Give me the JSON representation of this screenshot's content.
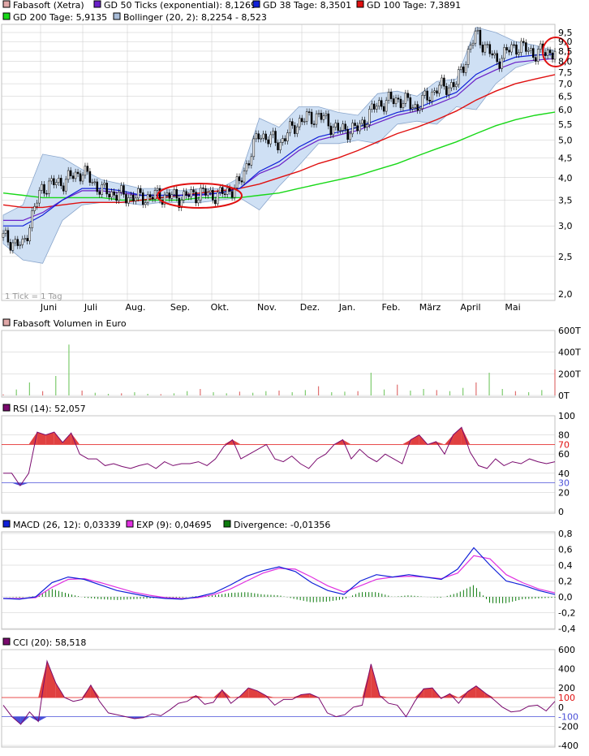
{
  "colors": {
    "gd50": "#6a1fc8",
    "gd38": "#1020d8",
    "gd100": "#e01010",
    "gd200": "#18d818",
    "boll_fill": "#cfe0f4",
    "boll_line": "#8aa6cc",
    "volume": "#7ecb6e",
    "rsi_line": "#7a0a6e",
    "rsi_fill": "#e04040",
    "rsi_low_fill": "#4a50d8",
    "macd": "#1020d8",
    "exp": "#e030e0",
    "divergence": "#0c7a0c",
    "grid": "#c8c8c8"
  },
  "price_panel": {
    "legend": [
      {
        "label": "Fabasoft (Xetra)",
        "color": "#e0a8a8"
      },
      {
        "label": "GD 50 Ticks (exponential): 8,1269",
        "color": "#6a1fc8"
      },
      {
        "label": "GD 38 Tage: 8,3501",
        "color": "#1020d8"
      },
      {
        "label": "GD 100 Tage: 7,3891",
        "color": "#e01010"
      },
      {
        "label": "GD 200 Tage: 5,9135",
        "color": "#18d818"
      },
      {
        "label": "Bollinger (20, 2): 8,2254  - 8,523",
        "color": "#a8bcd8"
      }
    ],
    "tick_note": "1 Tick = 1 Tag",
    "y_labels": [
      "9,5",
      "9,0",
      "8,5",
      "8,0",
      "7,5",
      "7,0",
      "6,5",
      "6,0",
      "5,5",
      "5,0",
      "4,5",
      "4,0",
      "3,5",
      "3,0",
      "2,5",
      "2,0"
    ],
    "x_labels": [
      "Juni",
      "Juli",
      "Aug.",
      "Sep.",
      "Okt.",
      "Nov.",
      "Dez.",
      "Jan.",
      "Feb.",
      "März",
      "April",
      "Mai"
    ]
  },
  "volume_panel": {
    "legend": {
      "label": "Fabasoft Volumen in Euro",
      "color": "#e0a8a8"
    },
    "y_labels": [
      "600T",
      "400T",
      "200T",
      "0T"
    ]
  },
  "rsi_panel": {
    "legend": {
      "label": "RSI (14): 52,057",
      "color": "#7a0a6e"
    },
    "y_labels": [
      "100",
      "80",
      "70",
      "60",
      "40",
      "30",
      "20",
      "0"
    ]
  },
  "macd_panel": {
    "legend": [
      {
        "label": "MACD (26, 12): 0,03339",
        "color": "#1020d8"
      },
      {
        "label": "EXP (9): 0,04695",
        "color": "#e030e0"
      },
      {
        "label": "Divergence: -0,01356",
        "color": "#0c7a0c"
      }
    ],
    "y_labels": [
      "0,8",
      "0,6",
      "0,4",
      "0,2",
      "0,0",
      "-0,2",
      "-0,4"
    ]
  },
  "cci_panel": {
    "legend": {
      "label": "CCI (20): 58,518",
      "color": "#7a0a6e"
    },
    "y_labels": [
      "600",
      "400",
      "200",
      "0",
      "100",
      "-100",
      "-200",
      "-400"
    ]
  },
  "chart_data": [
    {
      "type": "line",
      "title": "Fabasoft (Xetra)",
      "log_scale": true,
      "ylim": [
        2.0,
        9.5
      ],
      "x_ticks": [
        "Juni",
        "Juli",
        "Aug.",
        "Sep.",
        "Okt.",
        "Nov.",
        "Dez.",
        "Jan.",
        "Feb.",
        "März",
        "April",
        "Mai"
      ],
      "series": [
        {
          "name": "Fabasoft (Xetra)",
          "values": [
            2.8,
            2.65,
            3.8,
            3.9,
            4.15,
            3.7,
            3.6,
            3.55,
            3.6,
            3.55,
            3.65,
            3.6,
            3.85,
            5.2,
            4.9,
            5.6,
            5.8,
            5.3,
            5.35,
            6.2,
            6.4,
            6.1,
            6.8,
            7.0,
            9.4,
            8.0,
            8.8,
            8.4,
            8.5
          ]
        },
        {
          "name": "GD 50 Ticks (exponential)",
          "values": [
            3.1,
            3.1,
            3.25,
            3.5,
            3.7,
            3.7,
            3.65,
            3.6,
            3.6,
            3.6,
            3.6,
            3.65,
            3.75,
            4.1,
            4.3,
            4.7,
            5.0,
            5.15,
            5.3,
            5.55,
            5.8,
            5.95,
            6.2,
            6.5,
            7.2,
            7.6,
            7.95,
            8.05,
            8.13
          ]
        },
        {
          "name": "GD 38 Tage",
          "values": [
            3.0,
            3.0,
            3.2,
            3.5,
            3.75,
            3.75,
            3.7,
            3.6,
            3.6,
            3.6,
            3.62,
            3.65,
            3.75,
            4.15,
            4.4,
            4.8,
            5.1,
            5.25,
            5.4,
            5.65,
            5.9,
            6.05,
            6.35,
            6.65,
            7.4,
            7.85,
            8.2,
            8.3,
            8.35
          ]
        },
        {
          "name": "GD 100 Tage",
          "values": [
            3.4,
            3.35,
            3.35,
            3.4,
            3.45,
            3.45,
            3.45,
            3.5,
            3.55,
            3.6,
            3.65,
            3.7,
            3.75,
            3.85,
            4.0,
            4.15,
            4.35,
            4.5,
            4.7,
            4.95,
            5.2,
            5.4,
            5.65,
            5.95,
            6.35,
            6.7,
            7.0,
            7.2,
            7.39
          ]
        },
        {
          "name": "GD 200 Tage",
          "values": [
            3.65,
            3.6,
            3.55,
            3.55,
            3.55,
            3.55,
            3.5,
            3.5,
            3.5,
            3.5,
            3.55,
            3.55,
            3.55,
            3.6,
            3.65,
            3.75,
            3.85,
            3.95,
            4.05,
            4.2,
            4.35,
            4.55,
            4.75,
            4.95,
            5.2,
            5.45,
            5.65,
            5.8,
            5.91
          ]
        },
        {
          "name": "Bollinger (20, 2) upper",
          "values": [
            3.2,
            3.4,
            4.6,
            4.5,
            4.2,
            3.95,
            3.85,
            3.75,
            3.75,
            3.7,
            3.75,
            3.75,
            4.0,
            5.7,
            5.4,
            6.1,
            6.1,
            5.9,
            5.8,
            6.6,
            6.7,
            6.5,
            7.1,
            7.2,
            9.8,
            9.5,
            9.0,
            8.8,
            8.52
          ]
        },
        {
          "name": "Bollinger (20, 2) lower",
          "values": [
            2.7,
            2.45,
            2.4,
            3.1,
            3.4,
            3.45,
            3.45,
            3.4,
            3.45,
            3.45,
            3.45,
            3.5,
            3.55,
            3.3,
            3.8,
            4.3,
            4.9,
            4.9,
            5.0,
            4.9,
            5.5,
            5.6,
            5.5,
            6.1,
            6.0,
            7.0,
            7.7,
            8.0,
            8.23
          ]
        }
      ]
    },
    {
      "type": "bar",
      "title": "Fabasoft Volumen in Euro",
      "ylim": [
        0,
        600
      ],
      "unit": "T",
      "values": [
        10,
        55,
        120,
        40,
        180,
        470,
        45,
        25,
        15,
        20,
        30,
        15,
        12,
        20,
        40,
        60,
        30,
        20,
        35,
        25,
        40,
        45,
        30,
        50,
        85,
        30,
        35,
        40,
        210,
        55,
        100,
        45,
        60,
        50,
        40,
        70,
        120,
        210,
        60,
        40,
        30,
        50,
        240
      ]
    },
    {
      "type": "line",
      "title": "RSI (14)",
      "ylim": [
        0,
        100
      ],
      "reference_lines": [
        70,
        30
      ],
      "values": [
        40,
        40,
        27,
        40,
        83,
        80,
        83,
        72,
        82,
        60,
        55,
        55,
        48,
        50,
        47,
        45,
        48,
        50,
        45,
        52,
        48,
        50,
        50,
        52,
        48,
        55,
        68,
        75,
        55,
        60,
        65,
        70,
        55,
        52,
        58,
        50,
        45,
        55,
        60,
        70,
        75,
        55,
        65,
        57,
        52,
        60,
        55,
        50,
        75,
        80,
        70,
        73,
        60,
        80,
        88,
        62,
        48,
        45,
        55,
        48,
        52,
        50,
        55,
        52,
        50,
        52
      ]
    },
    {
      "type": "line",
      "title": "MACD (26, 12)",
      "ylim": [
        -0.4,
        0.8
      ],
      "series": [
        {
          "name": "MACD (26, 12)",
          "values": [
            -0.02,
            -0.03,
            0.0,
            0.18,
            0.25,
            0.22,
            0.15,
            0.08,
            0.04,
            0.0,
            -0.02,
            -0.03,
            0.0,
            0.05,
            0.15,
            0.26,
            0.33,
            0.38,
            0.32,
            0.18,
            0.08,
            0.03,
            0.2,
            0.28,
            0.25,
            0.28,
            0.25,
            0.22,
            0.35,
            0.62,
            0.4,
            0.2,
            0.15,
            0.08,
            0.03
          ]
        },
        {
          "name": "EXP (9)",
          "values": [
            -0.02,
            -0.02,
            -0.01,
            0.12,
            0.22,
            0.23,
            0.18,
            0.12,
            0.06,
            0.02,
            -0.01,
            -0.02,
            -0.01,
            0.03,
            0.1,
            0.2,
            0.3,
            0.36,
            0.35,
            0.25,
            0.14,
            0.06,
            0.14,
            0.22,
            0.25,
            0.26,
            0.25,
            0.23,
            0.3,
            0.52,
            0.48,
            0.28,
            0.18,
            0.1,
            0.05
          ]
        },
        {
          "name": "Divergence",
          "values": [
            0,
            -0.01,
            0.01,
            0.1,
            0.04,
            -0.01,
            -0.03,
            -0.04,
            -0.03,
            -0.02,
            -0.01,
            -0.01,
            0.01,
            0.02,
            0.05,
            0.06,
            0.03,
            0.02,
            -0.03,
            -0.07,
            -0.06,
            -0.03,
            0.06,
            0.06,
            0.0,
            0.02,
            0.0,
            -0.01,
            0.05,
            0.15,
            -0.08,
            -0.08,
            -0.03,
            -0.02,
            -0.01
          ]
        }
      ]
    },
    {
      "type": "line",
      "title": "CCI (20)",
      "ylim": [
        -400,
        600
      ],
      "reference_lines": [
        100,
        -100
      ],
      "values": [
        20,
        -100,
        -180,
        -50,
        -150,
        480,
        250,
        100,
        60,
        80,
        230,
        60,
        -60,
        -80,
        -100,
        -120,
        -110,
        -70,
        -90,
        -30,
        40,
        60,
        120,
        30,
        50,
        180,
        40,
        110,
        200,
        170,
        120,
        20,
        80,
        80,
        130,
        140,
        100,
        -60,
        -100,
        -80,
        0,
        20,
        450,
        120,
        40,
        20,
        -100,
        60,
        190,
        200,
        90,
        140,
        40,
        160,
        220,
        150,
        80,
        0,
        -50,
        -40,
        10,
        20,
        -40,
        60
      ]
    }
  ]
}
